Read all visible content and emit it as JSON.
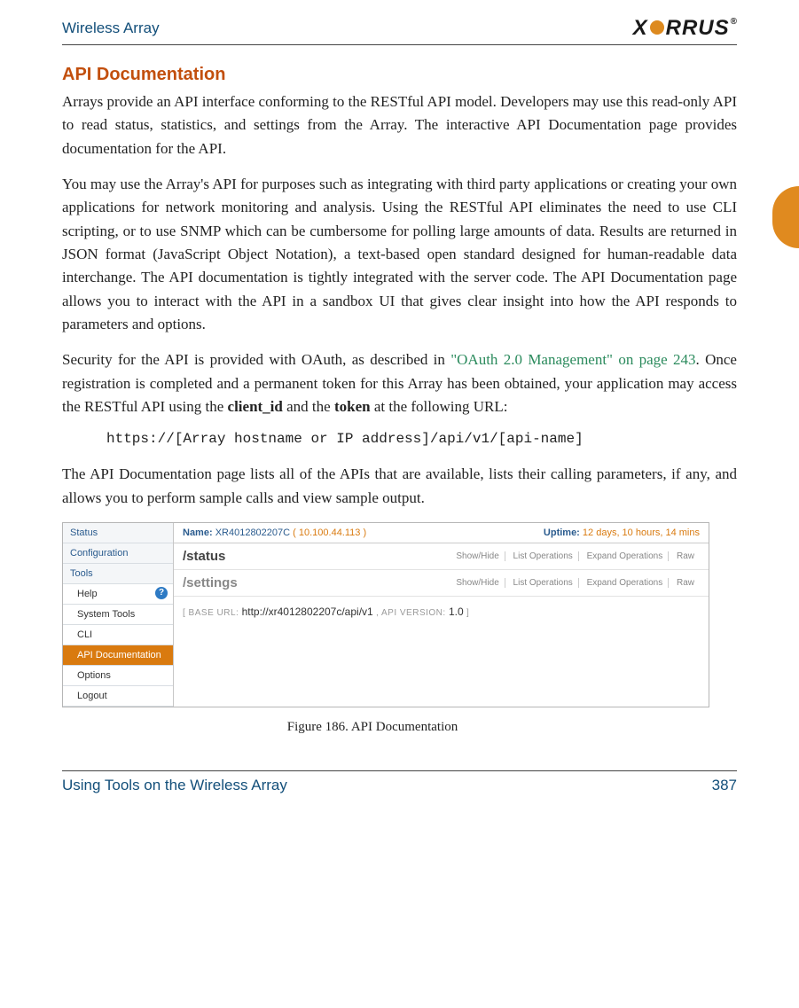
{
  "header": {
    "title": "Wireless Array",
    "logo_pre": "X",
    "logo_post": "RRUS"
  },
  "section_heading": "API Documentation",
  "p1": "Arrays provide an API interface conforming to the RESTful API model. Developers may use this read-only API to read status, statistics, and settings from the Array. The interactive API Documentation page provides documentation for the API.",
  "p2": "You may use the Array's API for purposes such as integrating with third party applications or creating your own applications for network monitoring and analysis. Using the RESTful API eliminates the need to use CLI scripting, or to use SNMP which can be cumbersome for polling large amounts of data. Results are returned in JSON format (JavaScript Object Notation), a text-based open standard designed for human-readable data interchange. The API documentation is tightly integrated with the server code. The API Documentation page allows you to interact with the API in a sandbox UI that gives clear insight into how the API responds to parameters and options.",
  "p3_pre": "Security for the API is provided with OAuth, as described in ",
  "p3_link": "\"OAuth 2.0 Management\" on page 243",
  "p3_mid": ". Once registration is completed and a permanent token for this Array has been obtained, your application may access the RESTful API using the ",
  "p3_b1": "client_id",
  "p3_and": " and the ",
  "p3_b2": "token",
  "p3_post": " at the following URL:",
  "code": "https://[Array hostname or IP address]/api/v1/[api-name]",
  "p4": "The API Documentation page lists all of the APIs that are available, lists their calling parameters, if any, and allows you to perform sample calls and view sample output.",
  "shot": {
    "sidebar": {
      "status": "Status",
      "config": "Configuration",
      "tools": "Tools",
      "help": "Help",
      "systools": "System Tools",
      "cli": "CLI",
      "apidoc": "API Documentation",
      "options": "Options",
      "logout": "Logout"
    },
    "info": {
      "name_label": "Name:",
      "name_val": "XR4012802207C",
      "ip": "( 10.100.44.113 )",
      "uptime_label": "Uptime:",
      "uptime_val": "12 days, 10 hours, 14 mins"
    },
    "api1": "/status",
    "api2": "/settings",
    "ops": {
      "show": "Show/Hide",
      "list": "List Operations",
      "expand": "Expand Operations",
      "raw": "Raw"
    },
    "base_label_pre": "[ BASE URL:",
    "base_url": "http://xr4012802207c/api/v1",
    "base_label_mid": ", API VERSION:",
    "base_ver": "1.0",
    "base_label_post": "]"
  },
  "caption": "Figure 186. API Documentation",
  "footer": {
    "title": "Using Tools on the Wireless Array",
    "page": "387"
  }
}
